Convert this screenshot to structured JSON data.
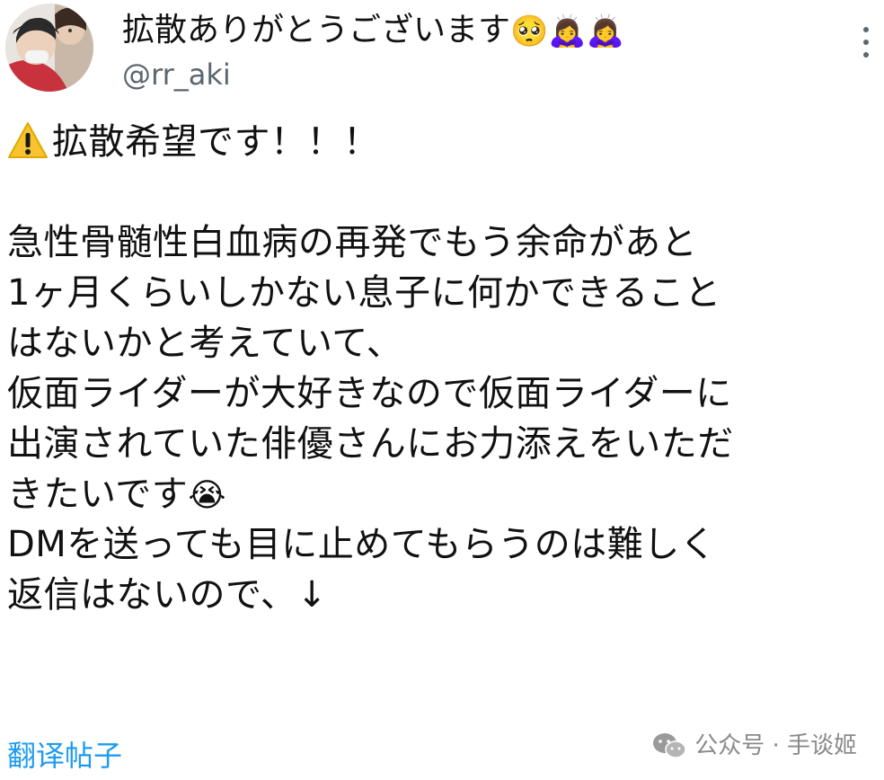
{
  "tweet": {
    "display_name": "拡散ありがとうございます",
    "name_emojis": [
      "🥺",
      "🙇‍♀️",
      "🙇‍♀️"
    ],
    "handle": "@rr_aki",
    "more_icon": "more-vertical-icon",
    "lines": [
      "拡散希望です！！！",
      "",
      "急性骨髄性白血病の再発でもう余命があと",
      "1ヶ月くらいしかない息子に何かできること",
      "はないかと考えていて、",
      "仮面ライダーが大好きなので仮面ライダーに",
      "出演されていた俳優さんにお力添えをいただ",
      "きたいです",
      "DMを送っても目に止めてもらうのは難しく",
      "返信はないので、↓"
    ],
    "warning_icon": "warning-icon",
    "crying_emoji": "😭",
    "translate_label": "翻译帖子"
  },
  "watermark": {
    "text": "公众号 · 手谈姬",
    "icon": "wechat-icon"
  },
  "colors": {
    "link": "#1d9bf0",
    "secondary": "#5b6670"
  }
}
